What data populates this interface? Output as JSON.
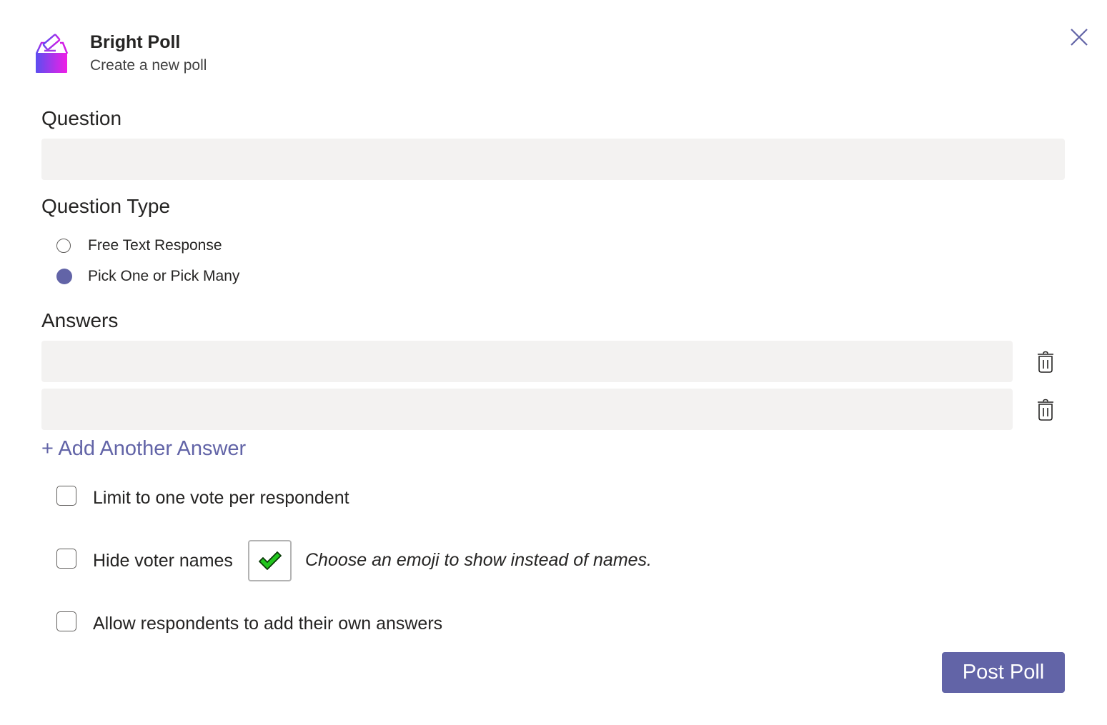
{
  "header": {
    "app_name": "Bright Poll",
    "subtitle": "Create a new poll",
    "logo_icon": "ballot-box-icon",
    "close_icon": "close-icon"
  },
  "question": {
    "label": "Question",
    "value": "",
    "placeholder": ""
  },
  "question_type": {
    "label": "Question Type",
    "options": [
      {
        "label": "Free Text Response",
        "selected": false
      },
      {
        "label": "Pick One or Pick Many",
        "selected": true
      }
    ]
  },
  "answers": {
    "label": "Answers",
    "items": [
      {
        "value": "",
        "placeholder": ""
      },
      {
        "value": "",
        "placeholder": ""
      }
    ],
    "delete_icon": "trash-icon",
    "add_label": "+ Add Another Answer"
  },
  "options": {
    "limit_one_vote": {
      "label": "Limit to one vote per respondent",
      "checked": false
    },
    "hide_voter_names": {
      "label": "Hide voter names",
      "checked": false
    },
    "emoji": {
      "icon": "check-mark-emoji-icon",
      "hint": "Choose an emoji to show instead of names."
    },
    "allow_own_answers": {
      "label": "Allow respondents to add their own answers",
      "checked": false
    }
  },
  "footer": {
    "post_label": "Post Poll"
  },
  "colors": {
    "accent": "#6264a7",
    "input_bg": "#f3f2f1",
    "text": "#252423"
  }
}
